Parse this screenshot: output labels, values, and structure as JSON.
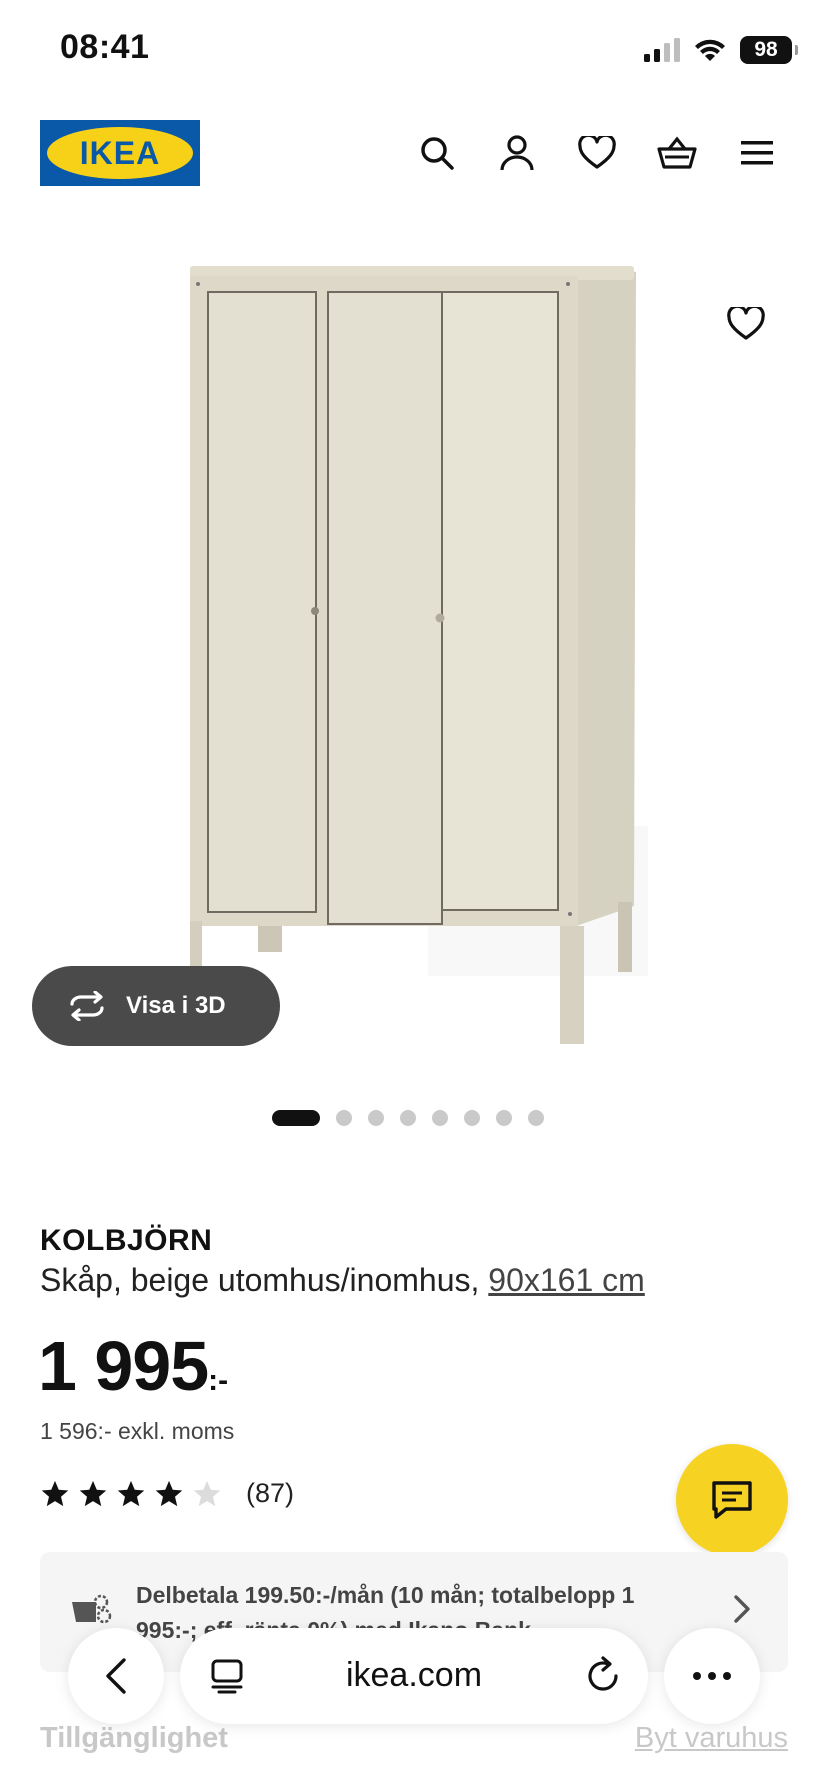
{
  "status_bar": {
    "time": "08:41",
    "battery": "98",
    "icons": [
      "signal-icon",
      "wifi-icon",
      "battery-icon"
    ]
  },
  "header": {
    "logo_text": "IKEA",
    "icons": [
      "search-icon",
      "account-icon",
      "heart-icon",
      "basket-icon",
      "menu-icon"
    ]
  },
  "gallery": {
    "view_3d_label": "Visa i 3D",
    "dot_count": 8,
    "active_dot": 1
  },
  "product": {
    "name": "KOLBJÖRN",
    "description": "Skåp, beige utomhus/inomhus, ",
    "size_link": "90x161 cm",
    "price_main": "1 995",
    "price_suffix": ":-",
    "price_ex_vat": "1 596:- exkl. moms",
    "rating_value": 4,
    "rating_max": 5,
    "rating_count": "(87)"
  },
  "installment": {
    "text": "Delbetala 199.50:-/mån (10 mån; totalbelopp 1 995:-; eff. ränta 0%) med Ikano Bank"
  },
  "availability": {
    "label": "Tillgänglighet",
    "change_store": "Byt varuhus"
  },
  "browser": {
    "domain": "ikea.com"
  },
  "colors": {
    "ikea_blue": "#0a58a8",
    "ikea_yellow": "#f7d117",
    "chat_yellow": "#f6d323",
    "button_dark": "#4a4a4a"
  }
}
